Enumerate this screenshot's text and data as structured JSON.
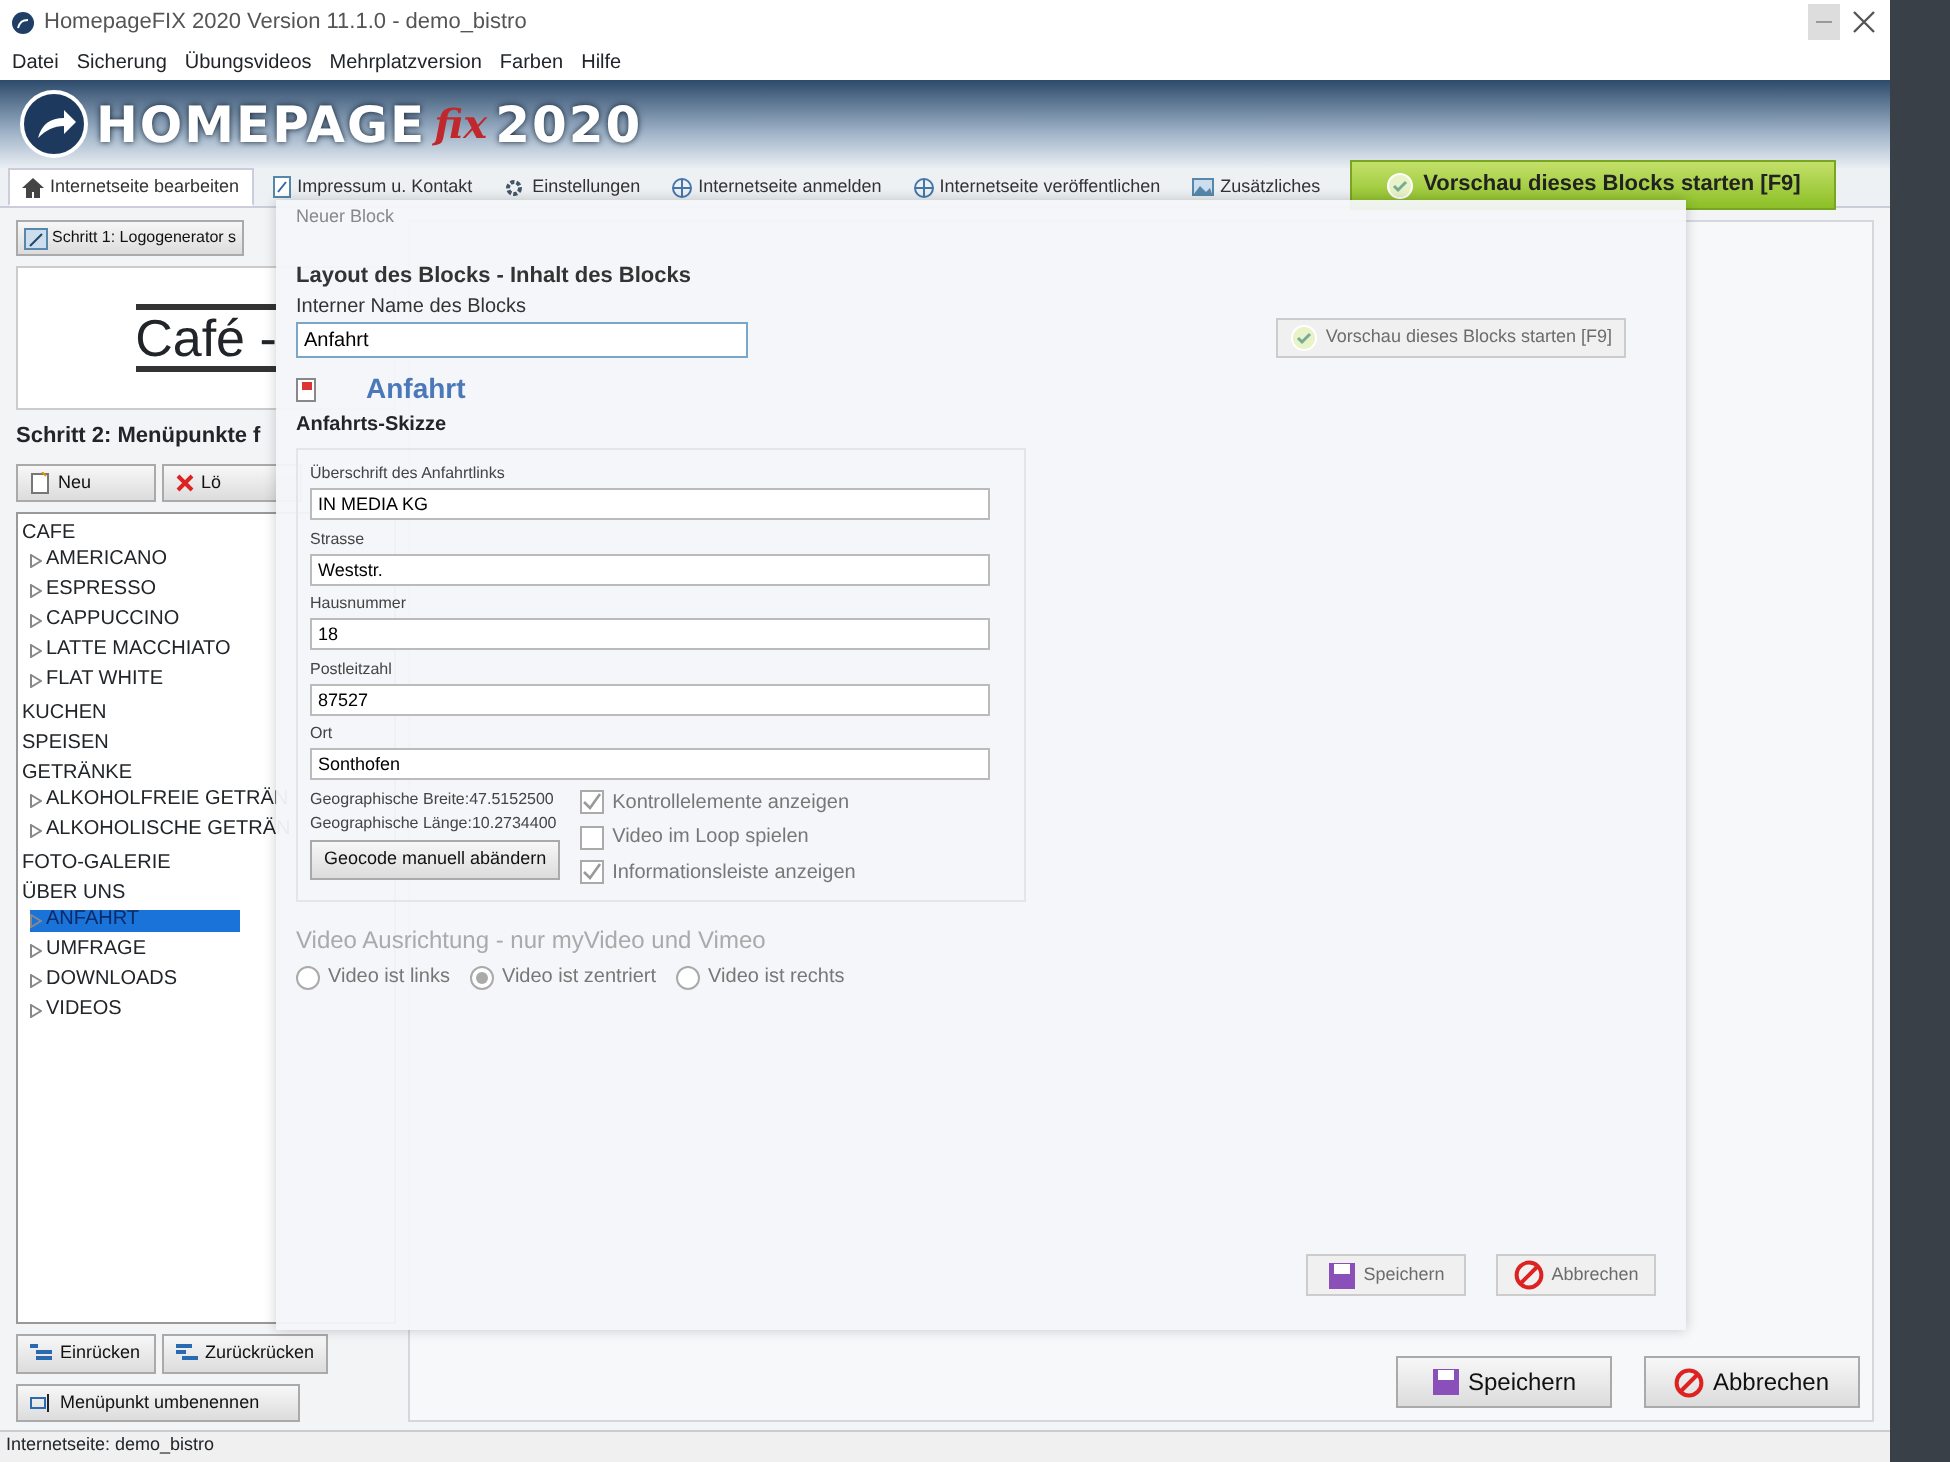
{
  "window": {
    "title": "HomepageFIX 2020 Version 11.1.0 - demo_bistro"
  },
  "menu": [
    "Datei",
    "Sicherung",
    "Übungsvideos",
    "Mehrplatzversion",
    "Farben",
    "Hilfe"
  ],
  "banner": {
    "logo_text": "HOMEPAGE",
    "logo_script": "fix",
    "logo_year": "2020"
  },
  "tabs": [
    {
      "label": "Internetseite bearbeiten",
      "selected": true
    },
    {
      "label": "Impressum u. Kontakt",
      "selected": false
    },
    {
      "label": "Einstellungen",
      "selected": false
    },
    {
      "label": "Internetseite anmelden",
      "selected": false
    },
    {
      "label": "Internetseite veröffentlichen",
      "selected": false
    },
    {
      "label": "Zusätzliches",
      "selected": false
    }
  ],
  "preview_button": "Vorschau dieses Blocks starten [F9]",
  "left_panel": {
    "step1_button": "Schritt 1: Logogenerator s",
    "logo_preview": "Café -",
    "step2_heading": "Schritt 2: Menüpunkte f",
    "buttons": [
      {
        "label": "Neu",
        "kind": "new"
      },
      {
        "label": "Lö",
        "kind": "delete"
      }
    ],
    "tree": [
      {
        "label": "CAFE",
        "selected": false,
        "children": [
          {
            "label": "AMERICANO",
            "selected": false
          },
          {
            "label": "ESPRESSO",
            "selected": false
          },
          {
            "label": "CAPPUCCINO",
            "selected": false
          },
          {
            "label": "LATTE MACCHIATO",
            "selected": false
          },
          {
            "label": "FLAT WHITE",
            "selected": false
          }
        ]
      },
      {
        "label": "KUCHEN",
        "selected": false
      },
      {
        "label": "SPEISEN",
        "selected": false
      },
      {
        "label": "GETRÄNKE",
        "selected": false,
        "children": [
          {
            "label": "ALKOHOLFREIE GETRÄN",
            "selected": false
          },
          {
            "label": "ALKOHOLISCHE GETRÄN",
            "selected": false
          }
        ]
      },
      {
        "label": "FOTO-GALERIE",
        "selected": false
      },
      {
        "label": "ÜBER UNS",
        "selected": false,
        "children": [
          {
            "label": "ANFAHRT",
            "selected": true
          },
          {
            "label": "UMFRAGE",
            "selected": false
          },
          {
            "label": "DOWNLOADS",
            "selected": false
          },
          {
            "label": "VIDEOS",
            "selected": false
          }
        ]
      }
    ],
    "bottom_buttons": [
      {
        "label": "Einrücken",
        "kind": "indent"
      },
      {
        "label": "Zurückrücken",
        "kind": "outdent"
      }
    ],
    "rename_button": "Menüpunkt umbenennen"
  },
  "footer_buttons": [
    {
      "label": "Speichern",
      "kind": "save"
    },
    {
      "label": "Abbrechen",
      "kind": "cancel"
    }
  ],
  "status_bar": "Internetseite: demo_bistro",
  "dialog": {
    "caption": "Neuer Block",
    "heading": "Layout des Blocks - Inhalt des Blocks",
    "name_label": "Interner Name des Blocks",
    "name_value": "Anfahrt",
    "block_type": "Anfahrt",
    "section": "Anfahrts-Skizze",
    "preview_button": {
      "label": "Vorschau dieses Blocks starten [F9]",
      "disabled": true
    },
    "fields": [
      {
        "label": "Überschrift des Anfahrtlinks",
        "value": "IN MEDIA KG"
      },
      {
        "label": "Strasse",
        "value": "Weststr."
      },
      {
        "label": "Hausnummer",
        "value": "18"
      },
      {
        "label": "Postleitzahl",
        "value": "87527"
      },
      {
        "label": "Ort",
        "value": "Sonthofen"
      }
    ],
    "geo": [
      "Geographische Breite:47.5152500",
      "Geographische Länge:10.2734400"
    ],
    "geocode_button": "Geocode manuell abändern",
    "options": [
      {
        "label": "Kontrollelemente anzeigen",
        "checked": true
      },
      {
        "label": "Video im Loop spielen",
        "checked": false
      },
      {
        "label": "Informationsleiste anzeigen",
        "checked": true
      }
    ],
    "alignment": {
      "heading": "Video Ausrichtung - nur myVideo und Vimeo",
      "choices": [
        {
          "label": "Video ist links",
          "selected": false
        },
        {
          "label": "Video ist zentriert",
          "selected": true
        },
        {
          "label": "Video ist rechts",
          "selected": false
        }
      ]
    },
    "buttons": [
      {
        "label": "Speichern",
        "kind": "save",
        "disabled": true
      },
      {
        "label": "Abbrechen",
        "kind": "cancel",
        "disabled": true
      }
    ]
  }
}
